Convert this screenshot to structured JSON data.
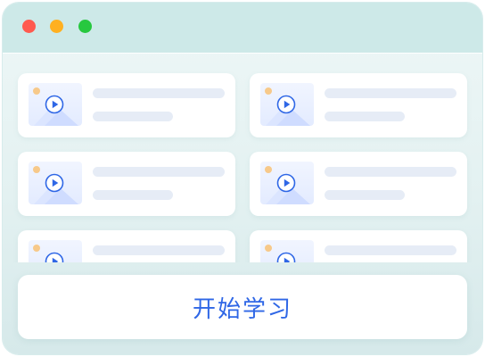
{
  "window": {
    "controls": [
      {
        "name": "close",
        "color": "#ff5a4f"
      },
      {
        "name": "minimize",
        "color": "#ffb020"
      },
      {
        "name": "maximize",
        "color": "#27c83f"
      }
    ]
  },
  "course_list": {
    "items": [
      {
        "thumbnail_icon": "play-icon"
      },
      {
        "thumbnail_icon": "play-icon"
      },
      {
        "thumbnail_icon": "play-icon"
      },
      {
        "thumbnail_icon": "play-icon"
      },
      {
        "thumbnail_icon": "play-icon"
      },
      {
        "thumbnail_icon": "play-icon"
      }
    ]
  },
  "actions": {
    "start_label": "开始学习"
  },
  "colors": {
    "accent": "#2f67e6",
    "titlebar": "#cde9e8",
    "placeholder_bar": "#e6ecf6"
  }
}
